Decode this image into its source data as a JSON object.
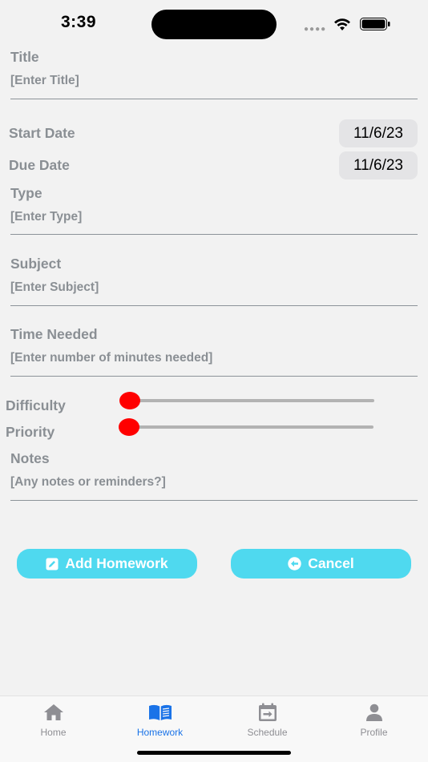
{
  "status_bar": {
    "time": "3:39"
  },
  "form": {
    "title": {
      "label": "Title",
      "placeholder": "[Enter Title]"
    },
    "start_date": {
      "label": "Start Date",
      "value": "11/6/23"
    },
    "due_date": {
      "label": "Due Date",
      "value": "11/6/23"
    },
    "type": {
      "label": "Type",
      "placeholder": "[Enter Type]"
    },
    "subject": {
      "label": "Subject",
      "placeholder": "[Enter Subject]"
    },
    "time_needed": {
      "label": "Time Needed",
      "placeholder": "[Enter number of minutes needed]"
    },
    "difficulty": {
      "label": "Difficulty",
      "value": 0
    },
    "priority": {
      "label": "Priority",
      "value": 0
    },
    "notes": {
      "label": "Notes",
      "placeholder": "[Any notes or reminders?]"
    }
  },
  "buttons": {
    "add": {
      "label": "Add Homework",
      "icon": "edit-icon"
    },
    "cancel": {
      "label": "Cancel",
      "icon": "arrow-left-circle-icon"
    }
  },
  "colors": {
    "accent": "#4fd9ef",
    "slider_thumb": "#ff0000",
    "tab_active": "#1a73e8"
  },
  "tabbar": {
    "items": [
      {
        "label": "Home",
        "icon": "home-icon",
        "active": false
      },
      {
        "label": "Homework",
        "icon": "book-icon",
        "active": true
      },
      {
        "label": "Schedule",
        "icon": "calendar-icon",
        "active": false
      },
      {
        "label": "Profile",
        "icon": "person-icon",
        "active": false
      }
    ]
  }
}
